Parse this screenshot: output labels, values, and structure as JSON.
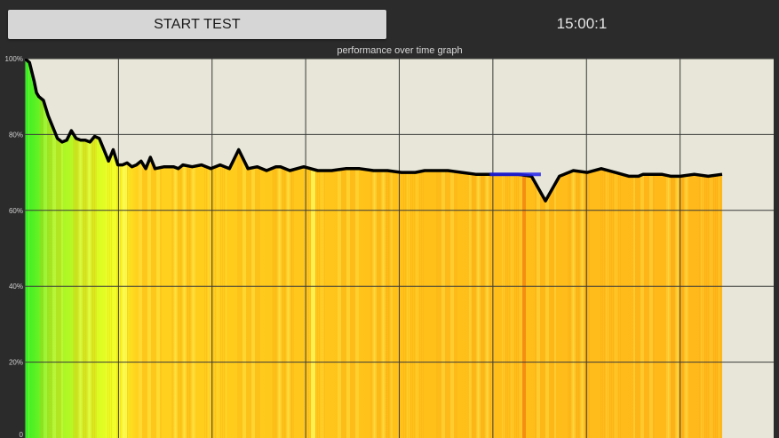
{
  "app": {
    "start_button_label": "START TEST",
    "timer_text": "15:00:1"
  },
  "colors": {
    "background": "#2b2b2b",
    "plot_background": "#e7e6d8",
    "grid": "#3a3a3a",
    "line": "#000000",
    "highlight_segment": "#2222ee",
    "fill_start": "#33ee22",
    "fill_mid": "#f2ff22",
    "fill_main": "#ffc21a"
  },
  "chart_data": {
    "type": "line",
    "title": "performance over time graph",
    "xlabel": "",
    "ylabel": "",
    "ylim": [
      0,
      100
    ],
    "xlim": [
      0,
      15
    ],
    "x_unit": "minutes",
    "y_ticks": [
      0,
      20,
      40,
      60,
      80,
      100
    ],
    "y_tick_labels": [
      "0",
      "20%",
      "40%",
      "60%",
      "80%",
      "100%"
    ],
    "grid": true,
    "vertical_grid_count": 8,
    "fill_under_line": true,
    "series": [
      {
        "name": "",
        "x": [
          0,
          0.1,
          0.2,
          0.25,
          0.3,
          0.4,
          0.5,
          0.6,
          0.7,
          0.8,
          0.9,
          1.0,
          1.1,
          1.2,
          1.3,
          1.4,
          1.5,
          1.6,
          1.7,
          1.8,
          1.9,
          2.0,
          2.1,
          2.2,
          2.3,
          2.4,
          2.5,
          2.6,
          2.7,
          2.8,
          3.0,
          3.2,
          3.3,
          3.4,
          3.6,
          3.8,
          4.0,
          4.2,
          4.4,
          4.6,
          4.8,
          5.0,
          5.2,
          5.4,
          5.5,
          5.7,
          6.0,
          6.3,
          6.6,
          6.9,
          7.2,
          7.5,
          7.8,
          8.1,
          8.4,
          8.6,
          8.8,
          9.1,
          9.4,
          9.7,
          10.0,
          10.3,
          10.6,
          10.9,
          11.2,
          11.5,
          11.8,
          12.1,
          12.4,
          12.7,
          13.0,
          13.2,
          13.3,
          13.5,
          13.7,
          13.9,
          14.1,
          14.4,
          14.7,
          15.0
        ],
        "y": [
          100,
          99,
          94,
          91,
          90,
          89,
          85,
          82,
          79,
          78,
          78.5,
          81,
          79,
          78.5,
          78.5,
          78,
          79.5,
          79,
          76,
          73,
          76,
          72,
          72,
          72.5,
          71.5,
          72,
          73,
          71,
          74,
          71,
          71.5,
          71.5,
          71,
          72,
          71.5,
          72,
          71,
          72,
          71,
          76,
          71,
          71.5,
          70.5,
          71.5,
          71.5,
          70.5,
          71.5,
          70.5,
          70.5,
          71,
          71,
          70.5,
          70.5,
          70,
          70,
          70.5,
          70.5,
          70.5,
          70,
          69.5,
          69.5,
          69.5,
          69.5,
          69,
          62.5,
          69,
          70.5,
          70,
          71,
          70,
          69,
          69,
          69.5,
          69.5,
          69.5,
          69,
          69,
          69.5,
          69,
          69.5
        ]
      }
    ],
    "highlight": {
      "x_start": 10.0,
      "x_end": 11.1,
      "y": 69.5,
      "color": "#2222ee"
    }
  }
}
